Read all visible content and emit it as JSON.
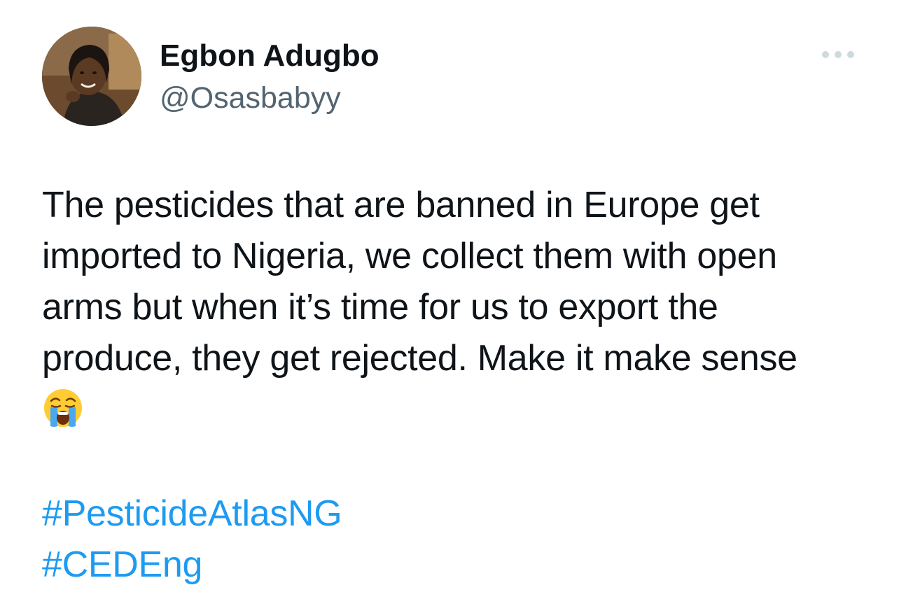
{
  "author": {
    "display_name": "Egbon Adugbo",
    "handle": "@Osasbabyy",
    "avatar_icon": "profile-photo"
  },
  "more_icon": "more-horizontal-icon",
  "tweet": {
    "lines": [
      "The pesticides that are banned in Europe get",
      "imported to Nigeria, we collect them with open",
      "arms but when it’s time for us to export the",
      "produce, they get rejected. Make it make sense"
    ],
    "emoji": "loudly-crying-face-emoji",
    "hashtags": [
      "#PesticideAtlasNG",
      "#CEDEng"
    ]
  },
  "colors": {
    "text": "#0f1419",
    "secondary_text": "#536471",
    "link": "#1d9bf0",
    "icon_gray": "#cfd9de"
  }
}
